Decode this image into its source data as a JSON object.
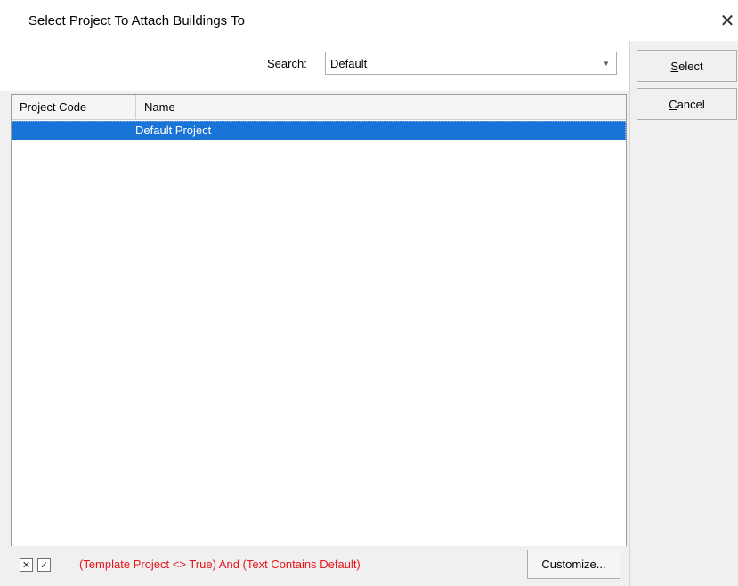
{
  "window": {
    "title": "Select Project To Attach Buildings To",
    "close_glyph": "✕"
  },
  "search": {
    "label": "Search:",
    "value": "Default",
    "dropdown_icon": "chevron-down-icon"
  },
  "grid": {
    "columns": [
      "Project Code",
      "Name"
    ],
    "rows": [
      {
        "code": "",
        "name": "Default Project",
        "selected": true
      }
    ]
  },
  "filter": {
    "clear_icon": "close-icon",
    "enable_icon": "check-icon",
    "text": "(Template Project <> True) And (Text Contains Default)",
    "customize_label": "Customize..."
  },
  "buttons": {
    "select": {
      "mnemonic": "S",
      "rest": "elect"
    },
    "cancel": {
      "mnemonic": "C",
      "rest": "ancel"
    }
  },
  "colors": {
    "selection": "#1a73d6",
    "filter_text": "#e8161a"
  }
}
